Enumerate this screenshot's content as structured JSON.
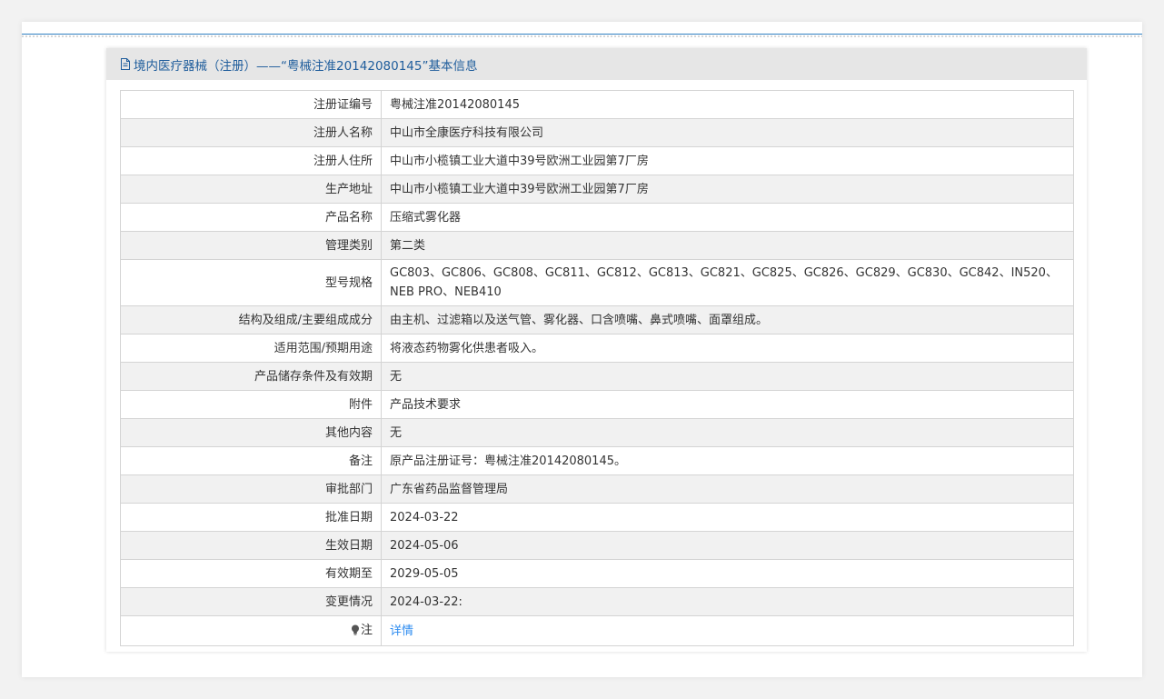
{
  "header": {
    "title": "境内医疗器械（注册）——“粤械注准20142080145”基本信息",
    "icon": "document-icon"
  },
  "rows": [
    {
      "label": "注册证编号",
      "value": "粤械注准20142080145"
    },
    {
      "label": "注册人名称",
      "value": "中山市全康医疗科技有限公司"
    },
    {
      "label": "注册人住所",
      "value": "中山市小榄镇工业大道中39号欧洲工业园第7厂房"
    },
    {
      "label": "生产地址",
      "value": "中山市小榄镇工业大道中39号欧洲工业园第7厂房"
    },
    {
      "label": "产品名称",
      "value": "压缩式雾化器"
    },
    {
      "label": "管理类别",
      "value": "第二类"
    },
    {
      "label": "型号规格",
      "value": "GC803、GC806、GC808、GC811、GC812、GC813、GC821、GC825、GC826、GC829、GC830、GC842、IN520、NEB PRO、NEB410"
    },
    {
      "label": "结构及组成/主要组成成分",
      "value": "由主机、过滤箱以及送气管、雾化器、口含喷嘴、鼻式喷嘴、面罩组成。"
    },
    {
      "label": "适用范围/预期用途",
      "value": "将液态药物雾化供患者吸入。"
    },
    {
      "label": "产品储存条件及有效期",
      "value": "无"
    },
    {
      "label": "附件",
      "value": "产品技术要求"
    },
    {
      "label": "其他内容",
      "value": "无"
    },
    {
      "label": "备注",
      "value": "原产品注册证号：粤械注准20142080145。"
    },
    {
      "label": "审批部门",
      "value": "广东省药品监督管理局"
    },
    {
      "label": "批准日期",
      "value": "2024-03-22"
    },
    {
      "label": "生效日期",
      "value": "2024-05-06"
    },
    {
      "label": "有效期至",
      "value": "2029-05-05"
    },
    {
      "label": "变更情况",
      "value": "2024-03-22:"
    }
  ],
  "note": {
    "label": "注",
    "icon": "lightbulb-icon",
    "link_text": "详情"
  },
  "colors": {
    "accent": "#1f5d9c",
    "link": "#2d8cf0",
    "rule": "#2f7fc1",
    "header_bg": "#e6e6e6",
    "stripe_bg": "#f1f1f1"
  }
}
